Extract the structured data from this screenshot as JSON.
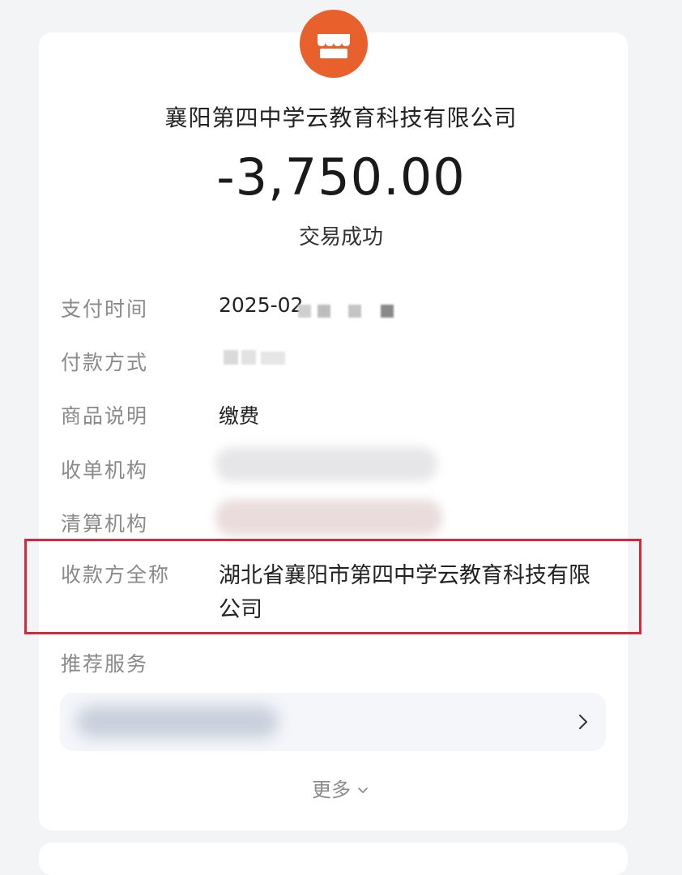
{
  "merchant": {
    "name": "襄阳第四中学云教育科技有限公司",
    "logo_icon": "storefront-icon",
    "logo_color": "#e8602c"
  },
  "transaction": {
    "amount": "-3,750.00",
    "status": "交易成功"
  },
  "details": {
    "pay_time_label": "支付时间",
    "pay_time_value": "2025-02",
    "payment_method_label": "付款方式",
    "goods_label": "商品说明",
    "goods_value": "缴费",
    "acquirer_label": "收单机构",
    "clearing_label": "清算机构",
    "payee_label": "收款方全称",
    "payee_value": "湖北省襄阳市第四中学云教育科技有限公司"
  },
  "recommend": {
    "label": "推荐服务",
    "arrow_icon": "chevron-right-icon"
  },
  "more": {
    "label": "更多",
    "icon": "chevron-down-icon"
  },
  "colors": {
    "highlight_border": "#d6283a",
    "accent": "#e8602c"
  }
}
